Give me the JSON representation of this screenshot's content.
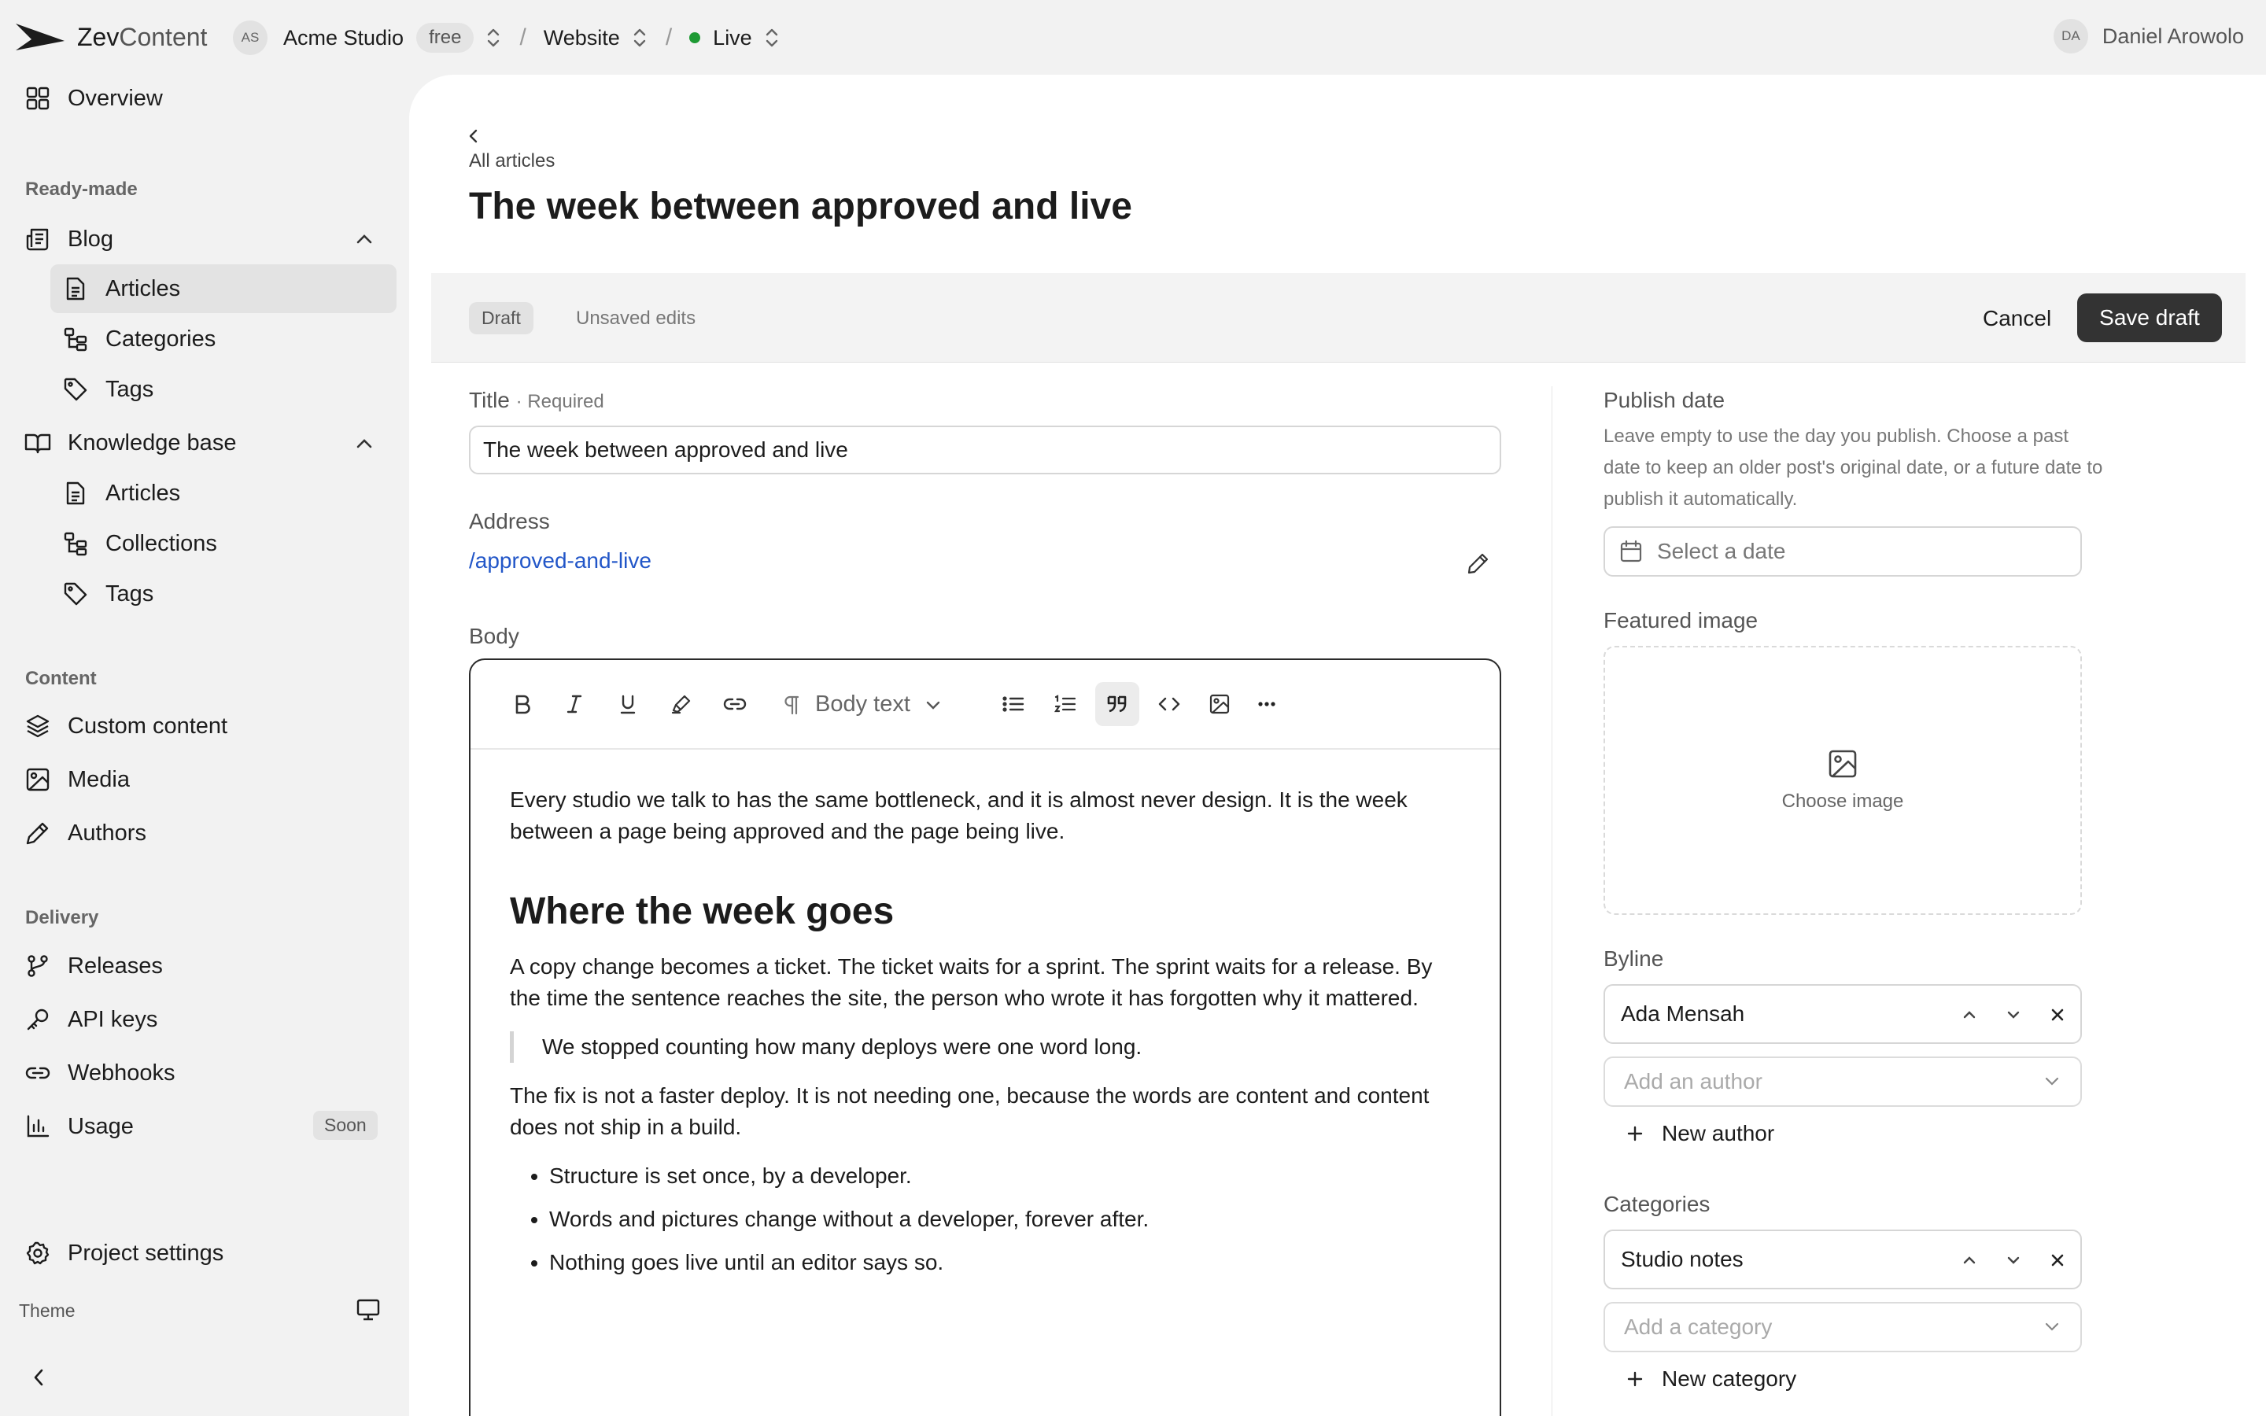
{
  "brand": {
    "name_bold": "Zev",
    "name_light": "Content"
  },
  "breadcrumb": {
    "workspace_initials": "AS",
    "workspace": "Acme Studio",
    "plan": "free",
    "project": "Website",
    "environment": "Live",
    "environment_color": "#1e9a34"
  },
  "user": {
    "initials": "DA",
    "name": "Daniel Arowolo"
  },
  "sidebar": {
    "overview": "Overview",
    "sections": {
      "ready_made": "Ready-made",
      "content": "Content",
      "delivery": "Delivery"
    },
    "blog": {
      "label": "Blog",
      "items": [
        "Articles",
        "Categories",
        "Tags"
      ]
    },
    "knowledge_base": {
      "label": "Knowledge base",
      "items": [
        "Articles",
        "Collections",
        "Tags"
      ]
    },
    "content_items": [
      "Custom content",
      "Media",
      "Authors"
    ],
    "delivery_items": [
      "Releases",
      "API keys",
      "Webhooks",
      "Usage"
    ],
    "usage_badge": "Soon",
    "project_settings": "Project settings",
    "theme_label": "Theme"
  },
  "page": {
    "back_label": "All articles",
    "title": "The week between approved and live"
  },
  "status": {
    "badge": "Draft",
    "note": "Unsaved edits",
    "cancel": "Cancel",
    "save": "Save draft"
  },
  "form": {
    "title_label": "Title",
    "required_label": "Required",
    "title_value": "The week between approved and live",
    "address_label": "Address",
    "address_value": "/approved-and-live",
    "body_label": "Body"
  },
  "editor": {
    "paragraph_style": "Body text",
    "p1": "Every studio we talk to has the same bottleneck, and it is almost never design. It is the week between a page being approved and the page being live.",
    "h2": "Where the week goes",
    "p2": "A copy change becomes a ticket. The ticket waits for a sprint. The sprint waits for a release. By the time the sentence reaches the site, the person who wrote it has forgotten why it mattered.",
    "quote": "We stopped counting how many deploys were one word long.",
    "p3": "The fix is not a faster deploy. It is not needing one, because the words are content and content does not ship in a build.",
    "bullets": [
      "Structure is set once, by a developer.",
      "Words and pictures change without a developer, forever after.",
      "Nothing goes live until an editor says so."
    ]
  },
  "side_panel": {
    "publish_label": "Publish date",
    "publish_help": "Leave empty to use the day you publish. Choose a past date to keep an older post's original date, or a future date to publish it automatically.",
    "date_placeholder": "Select a date",
    "featured_label": "Featured image",
    "choose_image": "Choose image",
    "byline_label": "Byline",
    "byline_value": "Ada Mensah",
    "add_author": "Add an author",
    "new_author": "New author",
    "categories_label": "Categories",
    "category_value": "Studio notes",
    "add_category": "Add a category",
    "new_category": "New category"
  }
}
